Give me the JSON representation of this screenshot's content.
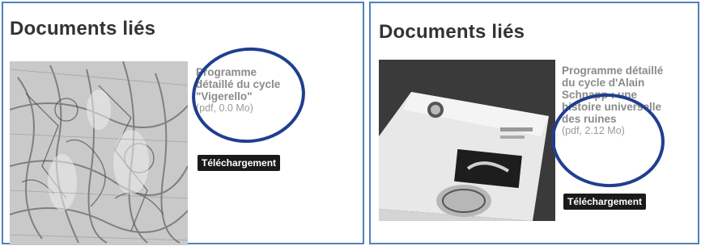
{
  "panels": [
    {
      "heading": "Documents liés",
      "doc_title": "Programme détaillé du cycle \"Vigerello\"",
      "doc_meta": "(pdf, 0.0 Mo)",
      "download_label": "Téléchargement"
    },
    {
      "heading": "Documents liés",
      "doc_title": "Programme détaillé du cycle d'Alain Schnapp : une histoire universelle des ruines",
      "doc_meta": "(pdf, 2.12 Mo)",
      "download_label": "Téléchargement"
    }
  ],
  "colors": {
    "frame_border": "#4f81bd",
    "annotation_ring": "#1f3f8f",
    "button_bg": "#1a1a1a",
    "title_text": "#8a8a8a"
  }
}
